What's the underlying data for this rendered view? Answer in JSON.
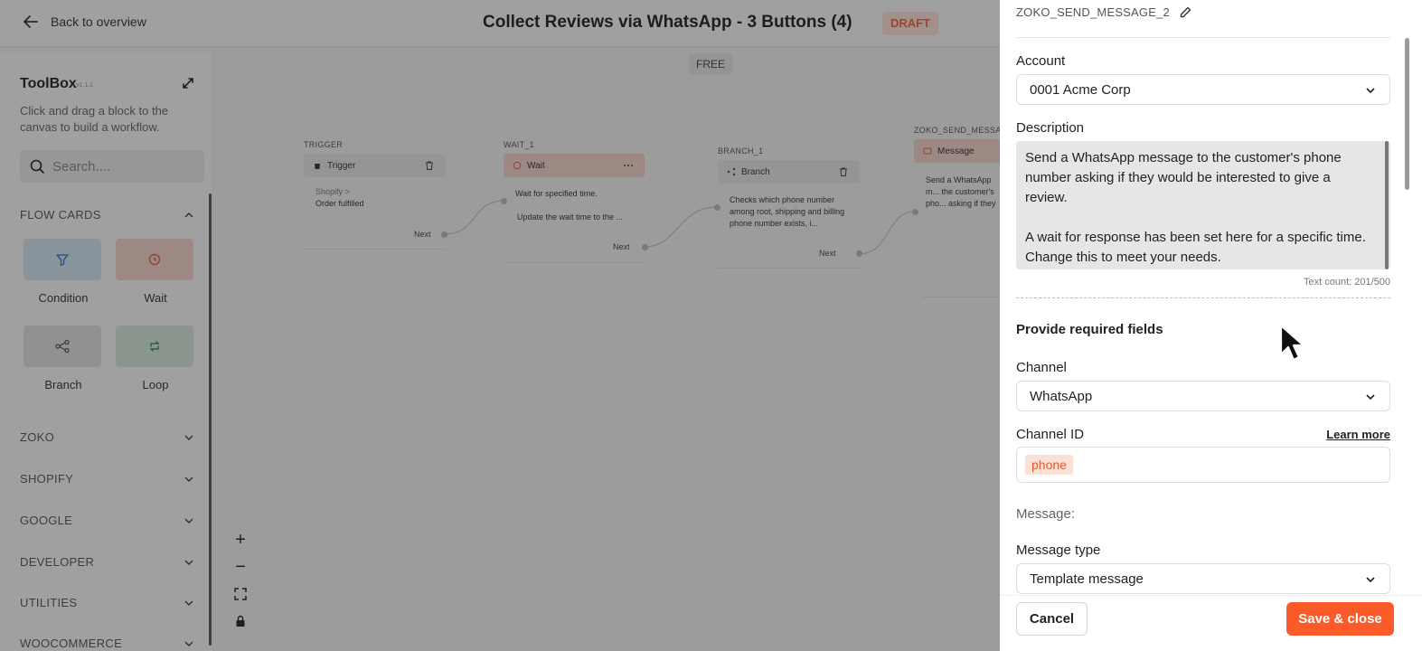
{
  "header": {
    "back_label": "Back to overview",
    "title": "Collect Reviews via WhatsApp - 3 Buttons (4)",
    "status_badge": "DRAFT"
  },
  "toolbox": {
    "title": "ToolBox",
    "version": "v1.1.1",
    "description": "Click and drag a block to the canvas to build a workflow.",
    "search_placeholder": "Search....",
    "flow_cards_label": "FLOW CARDS",
    "cards": [
      {
        "label": "Condition",
        "icon": "filter-icon",
        "color": "#d6e6f6"
      },
      {
        "label": "Wait",
        "icon": "clock-icon",
        "color": "#f6d4cc"
      },
      {
        "label": "Branch",
        "icon": "branch-icon",
        "color": "#e2e2e2"
      },
      {
        "label": "Loop",
        "icon": "loop-icon",
        "color": "#d7eadc"
      }
    ],
    "sections": [
      "ZOKO",
      "SHOPIFY",
      "GOOGLE",
      "DEVELOPER",
      "UTILITIES",
      "WOOCOMMERCE"
    ]
  },
  "canvas": {
    "plan_badge": "FREE",
    "nodes": [
      {
        "id": "TRIGGER",
        "head": "Trigger",
        "sub": "Shopify >",
        "text": "Order fulfilled",
        "next": "Next"
      },
      {
        "id": "WAIT_1",
        "head": "Wait",
        "text": "Wait for specified time.",
        "text2": "Update the wait time to the ...",
        "next": "Next"
      },
      {
        "id": "BRANCH_1",
        "head": "Branch",
        "text": "Checks which phone number among root, shipping and billing phone number exists, i...",
        "next": "Next"
      },
      {
        "id": "ZOKO_SEND_MESSAGE",
        "head": "Message",
        "text": "Send a WhatsApp m... the customer's pho... asking if they woul..."
      }
    ]
  },
  "panel": {
    "node_name": "ZOKO_SEND_MESSAGE_2",
    "account_label": "Account",
    "account_value": "0001 Acme Corp",
    "description_label": "Description",
    "description_p1": "Send a WhatsApp message to the customer's phone number asking if they would be interested to give a review.",
    "description_p2": "A wait for response has been set here for a specific time. Change this to meet your needs.",
    "text_count": "Text count: 201/500",
    "required_title": "Provide required fields",
    "channel_label": "Channel",
    "channel_value": "WhatsApp",
    "channel_id_label": "Channel ID",
    "learn_more": "Learn more",
    "channel_id_tag": "phone",
    "message_label": "Message:",
    "message_type_label": "Message type",
    "message_type_value": "Template message",
    "cancel_label": "Cancel",
    "save_label": "Save & close",
    "accent_color": "#fb5b2a"
  }
}
